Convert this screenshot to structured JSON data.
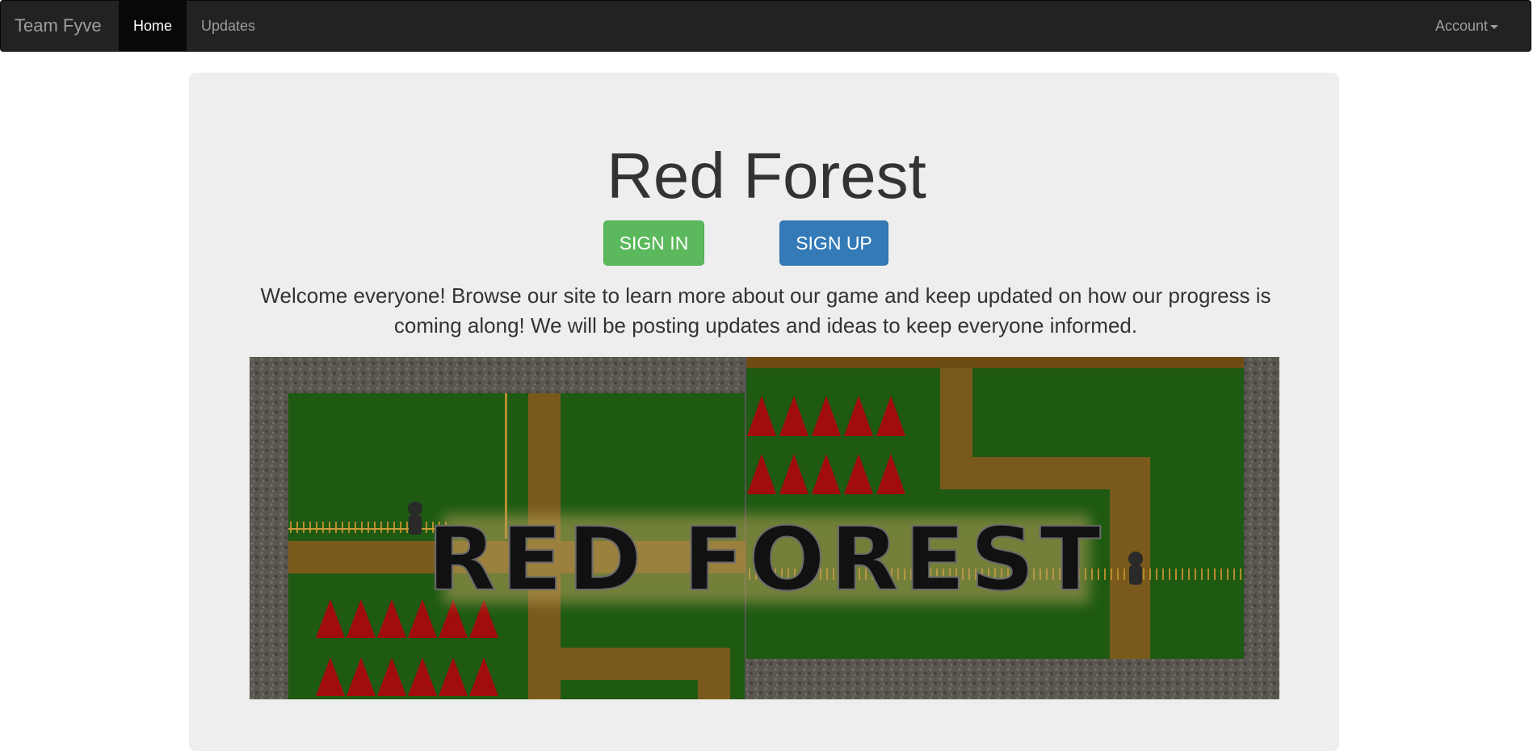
{
  "navbar": {
    "brand": "Team Fyve",
    "links": [
      {
        "label": "Home",
        "active": true
      },
      {
        "label": "Updates",
        "active": false
      }
    ],
    "account_label": "Account"
  },
  "hero": {
    "title": "Red Forest",
    "sign_in_label": "SIGN IN",
    "sign_up_label": "SIGN UP",
    "welcome_text": "Welcome everyone! Browse our site to learn more about our game and keep updated on how our progress is coming along! We will be posting updates and ideas to keep everyone informed."
  },
  "banner": {
    "title_text": "RED FOREST",
    "colors": {
      "grass": "#1e5a12",
      "stone": "#5a5650",
      "path": "#7a5a1c",
      "trees": "#a10c0c",
      "title": "#111111"
    }
  }
}
